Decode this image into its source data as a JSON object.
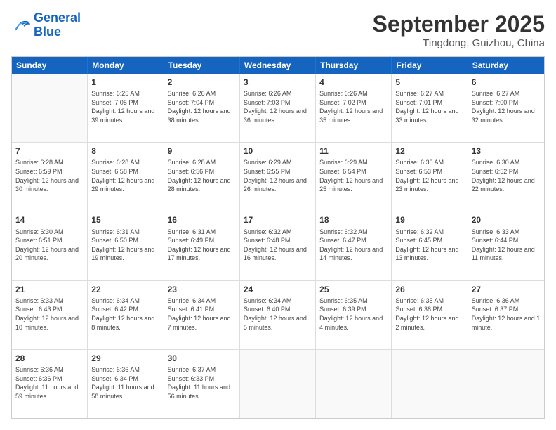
{
  "logo": {
    "line1": "General",
    "line2": "Blue"
  },
  "title": "September 2025",
  "location": "Tingdong, Guizhou, China",
  "days": [
    "Sunday",
    "Monday",
    "Tuesday",
    "Wednesday",
    "Thursday",
    "Friday",
    "Saturday"
  ],
  "rows": [
    [
      {
        "day": "",
        "empty": true
      },
      {
        "day": "1",
        "sunrise": "Sunrise: 6:25 AM",
        "sunset": "Sunset: 7:05 PM",
        "daylight": "Daylight: 12 hours and 39 minutes."
      },
      {
        "day": "2",
        "sunrise": "Sunrise: 6:26 AM",
        "sunset": "Sunset: 7:04 PM",
        "daylight": "Daylight: 12 hours and 38 minutes."
      },
      {
        "day": "3",
        "sunrise": "Sunrise: 6:26 AM",
        "sunset": "Sunset: 7:03 PM",
        "daylight": "Daylight: 12 hours and 36 minutes."
      },
      {
        "day": "4",
        "sunrise": "Sunrise: 6:26 AM",
        "sunset": "Sunset: 7:02 PM",
        "daylight": "Daylight: 12 hours and 35 minutes."
      },
      {
        "day": "5",
        "sunrise": "Sunrise: 6:27 AM",
        "sunset": "Sunset: 7:01 PM",
        "daylight": "Daylight: 12 hours and 33 minutes."
      },
      {
        "day": "6",
        "sunrise": "Sunrise: 6:27 AM",
        "sunset": "Sunset: 7:00 PM",
        "daylight": "Daylight: 12 hours and 32 minutes."
      }
    ],
    [
      {
        "day": "7",
        "sunrise": "Sunrise: 6:28 AM",
        "sunset": "Sunset: 6:59 PM",
        "daylight": "Daylight: 12 hours and 30 minutes."
      },
      {
        "day": "8",
        "sunrise": "Sunrise: 6:28 AM",
        "sunset": "Sunset: 6:58 PM",
        "daylight": "Daylight: 12 hours and 29 minutes."
      },
      {
        "day": "9",
        "sunrise": "Sunrise: 6:28 AM",
        "sunset": "Sunset: 6:56 PM",
        "daylight": "Daylight: 12 hours and 28 minutes."
      },
      {
        "day": "10",
        "sunrise": "Sunrise: 6:29 AM",
        "sunset": "Sunset: 6:55 PM",
        "daylight": "Daylight: 12 hours and 26 minutes."
      },
      {
        "day": "11",
        "sunrise": "Sunrise: 6:29 AM",
        "sunset": "Sunset: 6:54 PM",
        "daylight": "Daylight: 12 hours and 25 minutes."
      },
      {
        "day": "12",
        "sunrise": "Sunrise: 6:30 AM",
        "sunset": "Sunset: 6:53 PM",
        "daylight": "Daylight: 12 hours and 23 minutes."
      },
      {
        "day": "13",
        "sunrise": "Sunrise: 6:30 AM",
        "sunset": "Sunset: 6:52 PM",
        "daylight": "Daylight: 12 hours and 22 minutes."
      }
    ],
    [
      {
        "day": "14",
        "sunrise": "Sunrise: 6:30 AM",
        "sunset": "Sunset: 6:51 PM",
        "daylight": "Daylight: 12 hours and 20 minutes."
      },
      {
        "day": "15",
        "sunrise": "Sunrise: 6:31 AM",
        "sunset": "Sunset: 6:50 PM",
        "daylight": "Daylight: 12 hours and 19 minutes."
      },
      {
        "day": "16",
        "sunrise": "Sunrise: 6:31 AM",
        "sunset": "Sunset: 6:49 PM",
        "daylight": "Daylight: 12 hours and 17 minutes."
      },
      {
        "day": "17",
        "sunrise": "Sunrise: 6:32 AM",
        "sunset": "Sunset: 6:48 PM",
        "daylight": "Daylight: 12 hours and 16 minutes."
      },
      {
        "day": "18",
        "sunrise": "Sunrise: 6:32 AM",
        "sunset": "Sunset: 6:47 PM",
        "daylight": "Daylight: 12 hours and 14 minutes."
      },
      {
        "day": "19",
        "sunrise": "Sunrise: 6:32 AM",
        "sunset": "Sunset: 6:45 PM",
        "daylight": "Daylight: 12 hours and 13 minutes."
      },
      {
        "day": "20",
        "sunrise": "Sunrise: 6:33 AM",
        "sunset": "Sunset: 6:44 PM",
        "daylight": "Daylight: 12 hours and 11 minutes."
      }
    ],
    [
      {
        "day": "21",
        "sunrise": "Sunrise: 6:33 AM",
        "sunset": "Sunset: 6:43 PM",
        "daylight": "Daylight: 12 hours and 10 minutes."
      },
      {
        "day": "22",
        "sunrise": "Sunrise: 6:34 AM",
        "sunset": "Sunset: 6:42 PM",
        "daylight": "Daylight: 12 hours and 8 minutes."
      },
      {
        "day": "23",
        "sunrise": "Sunrise: 6:34 AM",
        "sunset": "Sunset: 6:41 PM",
        "daylight": "Daylight: 12 hours and 7 minutes."
      },
      {
        "day": "24",
        "sunrise": "Sunrise: 6:34 AM",
        "sunset": "Sunset: 6:40 PM",
        "daylight": "Daylight: 12 hours and 5 minutes."
      },
      {
        "day": "25",
        "sunrise": "Sunrise: 6:35 AM",
        "sunset": "Sunset: 6:39 PM",
        "daylight": "Daylight: 12 hours and 4 minutes."
      },
      {
        "day": "26",
        "sunrise": "Sunrise: 6:35 AM",
        "sunset": "Sunset: 6:38 PM",
        "daylight": "Daylight: 12 hours and 2 minutes."
      },
      {
        "day": "27",
        "sunrise": "Sunrise: 6:36 AM",
        "sunset": "Sunset: 6:37 PM",
        "daylight": "Daylight: 12 hours and 1 minute."
      }
    ],
    [
      {
        "day": "28",
        "sunrise": "Sunrise: 6:36 AM",
        "sunset": "Sunset: 6:36 PM",
        "daylight": "Daylight: 11 hours and 59 minutes."
      },
      {
        "day": "29",
        "sunrise": "Sunrise: 6:36 AM",
        "sunset": "Sunset: 6:34 PM",
        "daylight": "Daylight: 11 hours and 58 minutes."
      },
      {
        "day": "30",
        "sunrise": "Sunrise: 6:37 AM",
        "sunset": "Sunset: 6:33 PM",
        "daylight": "Daylight: 11 hours and 56 minutes."
      },
      {
        "day": "",
        "empty": true
      },
      {
        "day": "",
        "empty": true
      },
      {
        "day": "",
        "empty": true
      },
      {
        "day": "",
        "empty": true
      }
    ]
  ]
}
